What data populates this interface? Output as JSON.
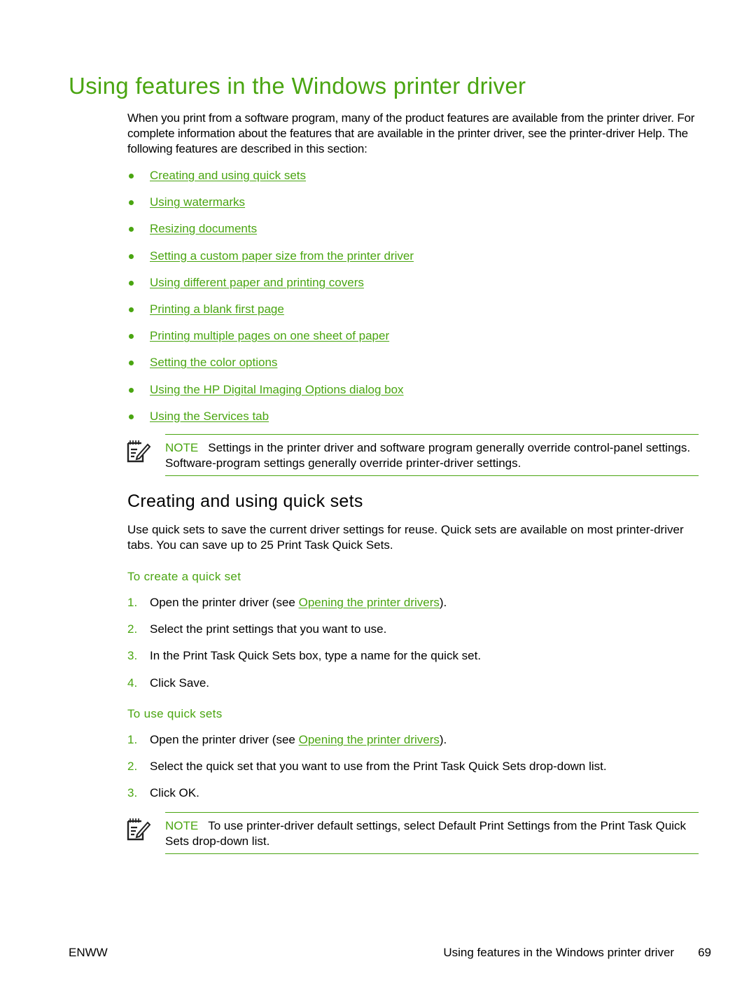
{
  "colors": {
    "accent": "#4aa511",
    "text": "#000000"
  },
  "page_title": "Using features in the Windows printer driver",
  "intro": "When you print from a software program, many of the product features are available from the printer driver. For complete information about the features that are available in the printer driver, see the printer-driver Help. The following features are described in this section:",
  "feature_links": [
    "Creating and using quick sets",
    "Using watermarks",
    "Resizing documents",
    "Setting a custom paper size from the printer driver",
    "Using different paper and printing covers",
    "Printing a blank first page",
    "Printing multiple pages on one sheet of paper",
    "Setting the color options",
    "Using the HP Digital Imaging Options dialog box",
    "Using the Services tab"
  ],
  "note1": {
    "icon": "note-pencil-icon",
    "label": "NOTE",
    "text": "Settings in the printer driver and software program generally override control-panel settings. Software-program settings generally override printer-driver settings."
  },
  "section": {
    "heading": "Creating and using quick sets",
    "intro": "Use quick sets to save the current driver settings for reuse. Quick sets are available on most printer-driver tabs. You can save up to 25 Print Task Quick Sets.",
    "create": {
      "heading": "To create a quick set",
      "steps": [
        {
          "num": "1.",
          "pre": "Open the printer driver (see ",
          "link": "Opening the printer drivers",
          "post": ")."
        },
        {
          "num": "2.",
          "text": "Select the print settings that you want to use."
        },
        {
          "num": "3.",
          "text": "In the Print Task Quick Sets box, type a name for the quick set."
        },
        {
          "num": "4.",
          "text": "Click Save."
        }
      ]
    },
    "use": {
      "heading": "To use quick sets",
      "steps": [
        {
          "num": "1.",
          "pre": "Open the printer driver (see ",
          "link": "Opening the printer drivers",
          "post": ")."
        },
        {
          "num": "2.",
          "text": "Select the quick set that you want to use from the Print Task Quick Sets drop-down list."
        },
        {
          "num": "3.",
          "text": "Click OK."
        }
      ]
    }
  },
  "note2": {
    "icon": "note-pencil-icon",
    "label": "NOTE",
    "text": "To use printer-driver default settings, select Default Print Settings from the Print Task Quick Sets drop-down list."
  },
  "footer": {
    "left": "ENWW",
    "section_title": "Using features in the Windows printer driver",
    "page_number": "69"
  }
}
